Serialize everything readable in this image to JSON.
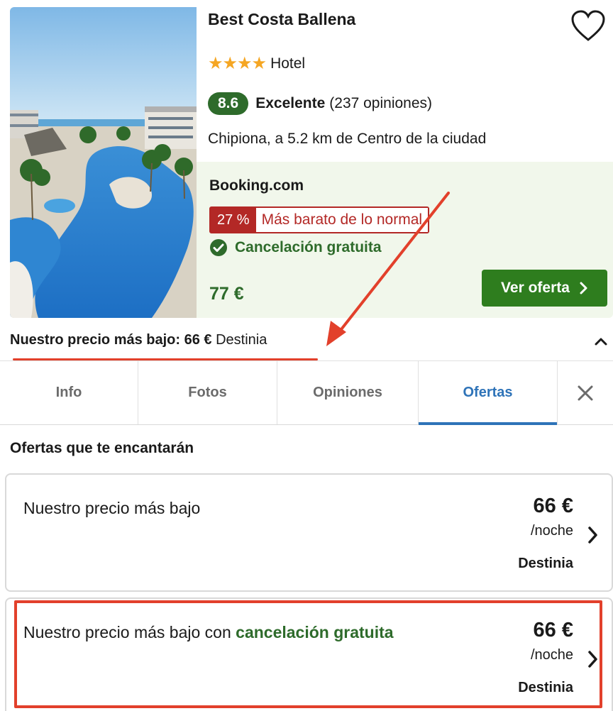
{
  "hotel": {
    "name": "Best Costa Ballena",
    "stars": "★★★★",
    "type": "Hotel",
    "rating": "8.6",
    "rating_word": "Excelente",
    "reviews": "(237 opiniones)",
    "location": "Chipiona, a 5.2 km de Centro de la ciudad"
  },
  "offer": {
    "provider": "Booking.com",
    "discount_pct": "27 %",
    "discount_text": "Más barato de lo normal",
    "cancellation": "Cancelación gratuita",
    "price": "77 €",
    "cta": "Ver oferta"
  },
  "lowest": {
    "label": "Nuestro precio más bajo: 66 €",
    "source": "Destinia"
  },
  "tabs": [
    {
      "label": "Info"
    },
    {
      "label": "Fotos"
    },
    {
      "label": "Opiniones"
    },
    {
      "label": "Ofertas"
    }
  ],
  "section_title": "Ofertas que te encantarán",
  "offers": [
    {
      "desc": "Nuestro precio más bajo",
      "price": "66 €",
      "per": "/noche",
      "source": "Destinia"
    },
    {
      "desc": "Nuestro precio más bajo con",
      "desc_green": "cancelación gratuita",
      "price": "66 €",
      "per": "/noche",
      "source": "Destinia"
    }
  ],
  "colors": {
    "accent_green": "#2e6b2b",
    "button_green": "#2e7d1e",
    "deal_red": "#b32826",
    "annotation_red": "#e2402b",
    "tab_blue": "#2e73b8",
    "star_orange": "#f5a623"
  },
  "icons": [
    "heart-icon",
    "check-circle-icon",
    "chevron-right-icon",
    "chevron-up-icon",
    "close-icon"
  ]
}
